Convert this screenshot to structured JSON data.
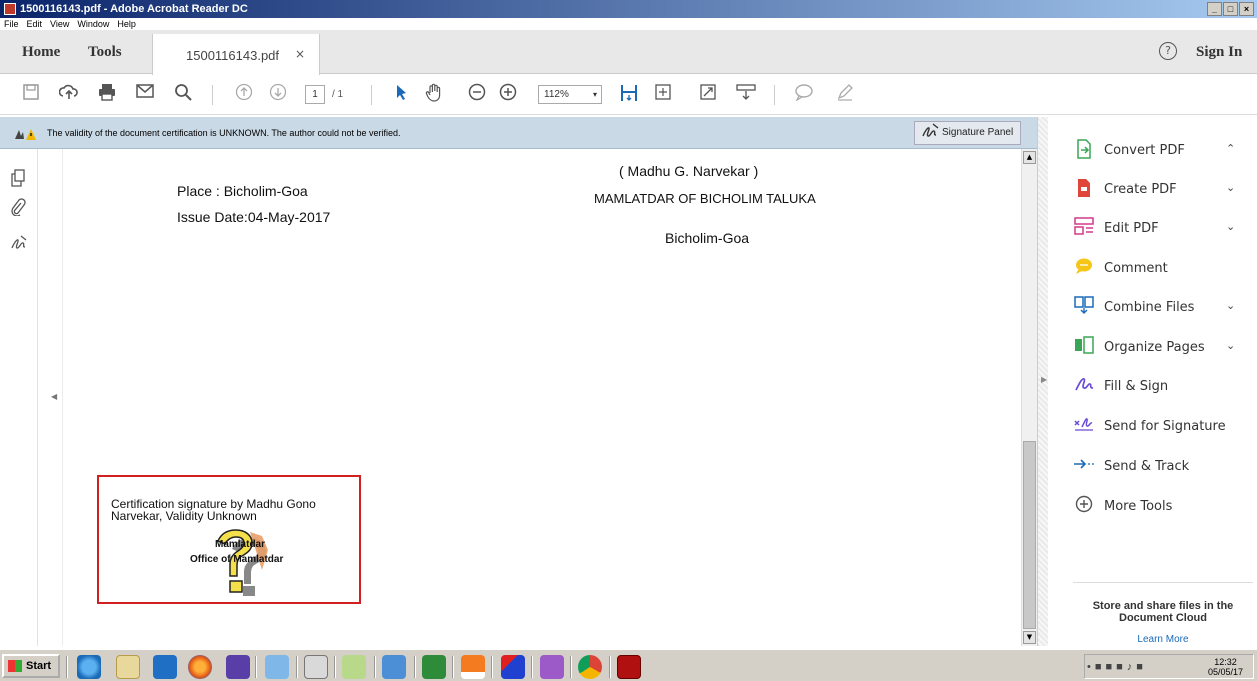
{
  "window": {
    "title": "1500116143.pdf - Adobe Acrobat Reader DC",
    "controls": [
      "_",
      "□",
      "×"
    ]
  },
  "menu": [
    "File",
    "Edit",
    "View",
    "Window",
    "Help"
  ],
  "tabbar": {
    "home": "Home",
    "tools": "Tools",
    "doc_tab": "1500116143.pdf",
    "close": "×",
    "help": "?",
    "signin": "Sign In"
  },
  "toolbar": {
    "page_current": "1",
    "page_total": "/ 1",
    "zoom": "112%",
    "zoom_arrow": "▾"
  },
  "notice": {
    "message": "The validity of the document certification is UNKNOWN. The author could not be verified.",
    "signature_panel": "Signature Panel"
  },
  "document": {
    "signer_name": "( Madhu G. Narvekar )",
    "designation": "MAMLATDAR OF BICHOLIM TALUKA",
    "place": "Place : Bicholim-Goa",
    "issue_date": "Issue Date:04-May-2017",
    "location": "Bicholim-Goa",
    "signature_box": {
      "line1": "Certification signature by Madhu Gono",
      "line2": "Narvekar, Validity Unknown",
      "line3": "Mamlatdar",
      "line4": "Office of Mamlatdar"
    }
  },
  "tools": [
    {
      "label": "Convert PDF",
      "icon": "convert-pdf-icon",
      "chevron": "⌃"
    },
    {
      "label": "Create PDF",
      "icon": "create-pdf-icon",
      "chevron": "⌄"
    },
    {
      "label": "Edit PDF",
      "icon": "edit-pdf-icon",
      "chevron": "⌄"
    },
    {
      "label": "Comment",
      "icon": "comment-icon",
      "chevron": ""
    },
    {
      "label": "Combine Files",
      "icon": "combine-files-icon",
      "chevron": "⌄"
    },
    {
      "label": "Organize Pages",
      "icon": "organize-pages-icon",
      "chevron": "⌄"
    },
    {
      "label": "Fill & Sign",
      "icon": "fill-sign-icon",
      "chevron": ""
    },
    {
      "label": "Send for Signature",
      "icon": "send-for-signature-icon",
      "chevron": ""
    },
    {
      "label": "Send & Track",
      "icon": "send-track-icon",
      "chevron": ""
    },
    {
      "label": "More Tools",
      "icon": "more-tools-icon",
      "chevron": ""
    }
  ],
  "cloud": {
    "text_line1": "Store and share files in the",
    "text_line2": "Document Cloud",
    "link": "Learn More"
  },
  "taskbar": {
    "start": "Start",
    "time": "12:32",
    "date": "05/05/17"
  },
  "colors": {
    "accent_red": "#d21f1f",
    "notice_bar": "#c9d9e6",
    "link_blue": "#1a6ab8"
  }
}
